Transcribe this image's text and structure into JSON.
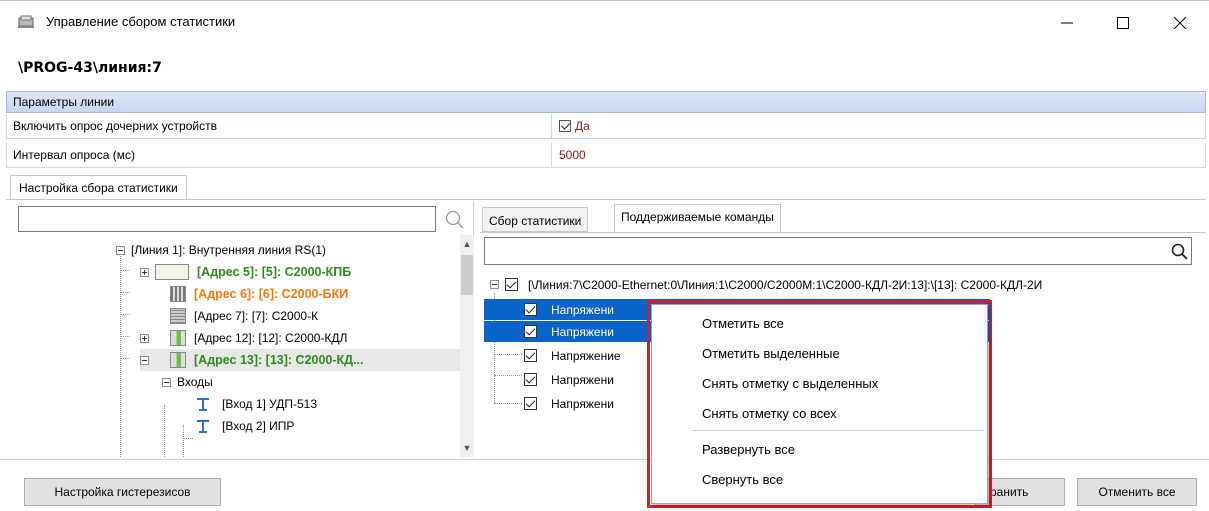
{
  "window": {
    "title": "Управление сбором статистики",
    "path": "\\PROG-43\\линия:7"
  },
  "params": {
    "header": "Параметры линии",
    "rows": [
      {
        "name": "Включить опрос дочерних устройств",
        "value": "Да"
      },
      {
        "name": "Интервал опроса (мс)",
        "value": "5000"
      }
    ]
  },
  "outer_tab": "Настройка сбора статистики",
  "tree": {
    "items": [
      {
        "label": "[Линия 1]: Внутренняя линия RS(1)"
      },
      {
        "label": "[Адрес 5]: [5]: С2000-КПБ"
      },
      {
        "label": "[Адрес 6]: [6]: С2000-БКИ"
      },
      {
        "label": "[Адрес 7]: [7]: С2000-К"
      },
      {
        "label": "[Адрес 12]: [12]: С2000-КДЛ"
      },
      {
        "label": "[Адрес 13]: [13]: С2000-КД..."
      },
      {
        "label": "Входы"
      },
      {
        "label": "[Вход 1] УДП-513"
      },
      {
        "label": "[Вход 2] ИПР"
      }
    ]
  },
  "right_tabs": [
    "Сбор статистики",
    "Поддерживаемые команды"
  ],
  "commands": {
    "root": "[\\Линия:7\\С2000-Ethernet:0\\Линия:1\\С2000/С2000М:1\\С2000-КДЛ-2И:13]:\\[13]: С2000-КДЛ-2И",
    "items": [
      "Напряжени",
      "Напряжени",
      "Напряжение",
      "Напряжени",
      "Напряжени"
    ]
  },
  "context_menu": {
    "items": [
      "Отметить все",
      "Отметить выделенные",
      "Снять отметку с выделенных",
      "Снять отметку со всех",
      "Развернуть все",
      "Свернуть все"
    ]
  },
  "buttons": {
    "hysteresis": "Настройка гистерезисов",
    "save": "ранить",
    "cancel_all": "Отменить все"
  },
  "colors": {
    "selection": "#0a63c8",
    "green": "#2e8b1e",
    "orange": "#f07a14",
    "value_red": "#8b1c1c",
    "highlight_frame": "#d81c2a"
  }
}
